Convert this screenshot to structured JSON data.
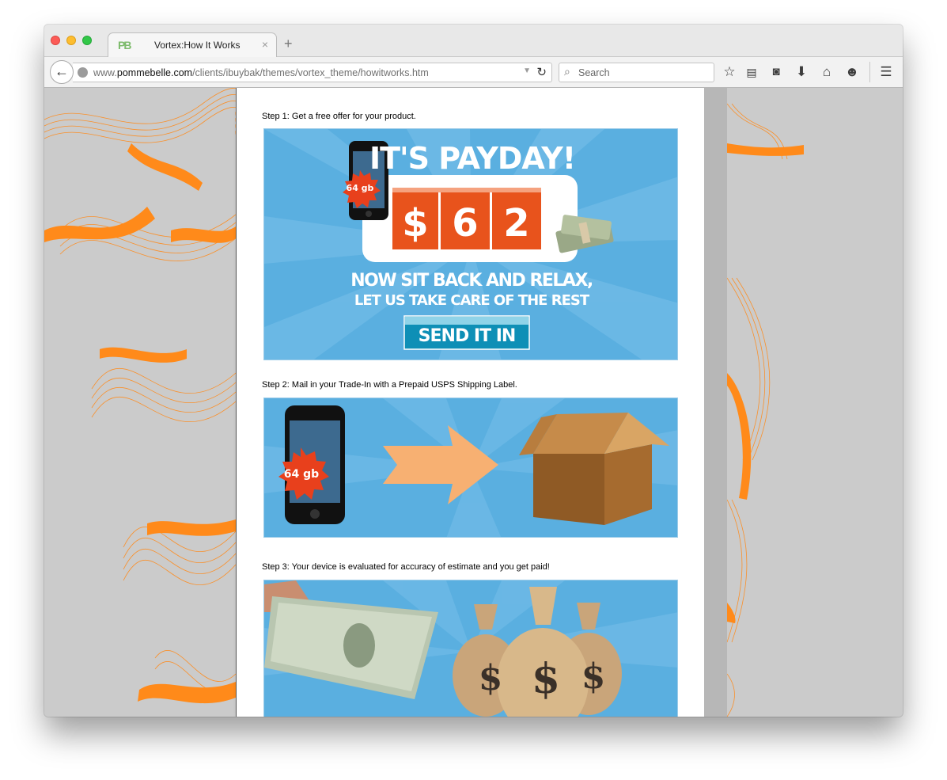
{
  "browser": {
    "tab_title": "Vortex:How It Works",
    "tab_close": "×",
    "new_tab": "+",
    "url_prefix": "www.",
    "url_domain": "pommebelle.com",
    "url_path": "/clients/ibuybak/themes/vortex_theme/howitworks.htm",
    "search_placeholder": "Search",
    "favicon_text": "PB"
  },
  "toolbar_icons": [
    "back-icon",
    "reload-icon",
    "search-icon",
    "bookmark-star-icon",
    "reading-list-icon",
    "pocket-icon",
    "download-icon",
    "home-icon",
    "hello-icon",
    "menu-icon"
  ],
  "steps": [
    {
      "label": "Step 1: Get a free offer for your product."
    },
    {
      "label": "Step 2: Mail in your Trade-In with a Prepaid USPS Shipping Label."
    },
    {
      "label": "Step 3: Your device is evaluated for accuracy of estimate and you get paid!"
    }
  ],
  "banner1": {
    "headline": "IT'S PAYDAY!",
    "digits": [
      "$",
      "6",
      "2"
    ],
    "badge": "64 gb",
    "line1": "NOW SIT BACK AND RELAX,",
    "line2": "LET US TAKE CARE OF THE REST",
    "button": "SEND IT IN"
  },
  "banner2": {
    "badge": "64 gb"
  },
  "banner3": {
    "bag_symbol": "$"
  },
  "colors": {
    "banner_blue": "#5aafe0",
    "digit_orange": "#e8531c",
    "ribbon_orange": "#ff8a1a",
    "button_teal": "#0e8fb6"
  }
}
